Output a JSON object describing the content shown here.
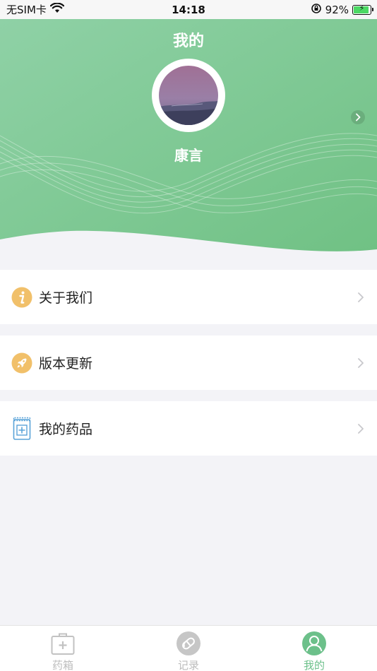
{
  "status_bar": {
    "carrier": "无SIM卡",
    "time": "14:18",
    "battery_percent": "92%",
    "battery_level": 0.92
  },
  "header": {
    "title": "我的",
    "profile_name": "康言",
    "gradient": [
      "#8cd0a4",
      "#72c185"
    ]
  },
  "menu": [
    {
      "label": "关于我们",
      "icon": "info-icon"
    },
    {
      "label": "版本更新",
      "icon": "rocket-icon"
    },
    {
      "label": "我的药品",
      "icon": "medicine-box-icon"
    }
  ],
  "tab_bar": {
    "tabs": [
      {
        "label": "药箱",
        "icon": "medicine-kit-icon",
        "active": false
      },
      {
        "label": "记录",
        "icon": "pill-record-icon",
        "active": false
      },
      {
        "label": "我的",
        "icon": "user-icon",
        "active": true
      }
    ],
    "active_color": "#6cc08a",
    "inactive_color": "#bdbdbd"
  }
}
